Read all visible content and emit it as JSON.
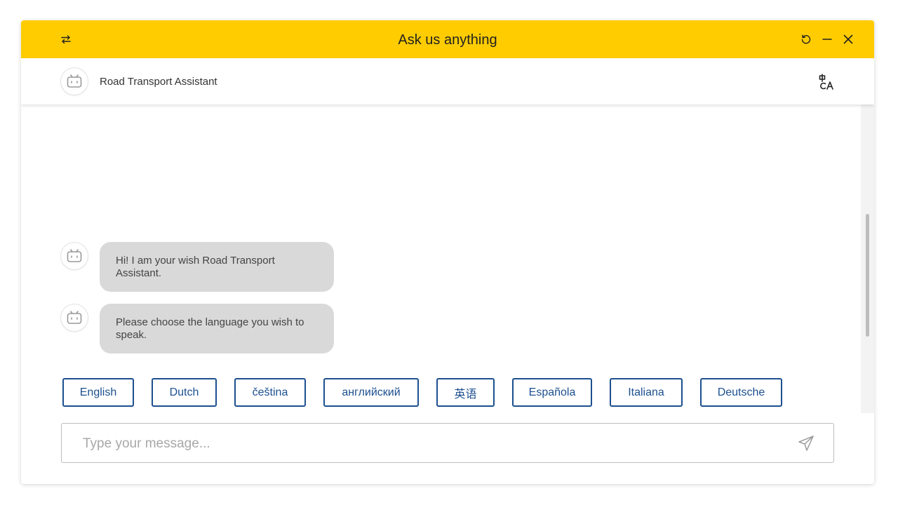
{
  "window": {
    "title": "Ask us anything",
    "accent_color": "#ffcc00"
  },
  "titlebar": {
    "left_icon": "swap-arrows-icon",
    "right_icons": [
      "refresh-icon",
      "minimize-icon",
      "close-icon"
    ]
  },
  "agent": {
    "name": "Road Transport Assistant",
    "avatar_icon": "bot-icon",
    "translate_icon": "translate-icon"
  },
  "messages": [
    {
      "sender": "bot",
      "text": "Hi! I am your wish Road Transport Assistant."
    },
    {
      "sender": "bot",
      "text": "Please choose the language you wish to speak."
    }
  ],
  "language_options": [
    "English",
    "Dutch",
    "čeština",
    "английский",
    "英语",
    "Española",
    "Italiana",
    "Deutsche"
  ],
  "composer": {
    "placeholder": "Type your message...",
    "value": "",
    "send_icon": "send-icon"
  },
  "colors": {
    "button_border": "#1c4f8f",
    "bubble_bg": "#d9d9d9"
  }
}
